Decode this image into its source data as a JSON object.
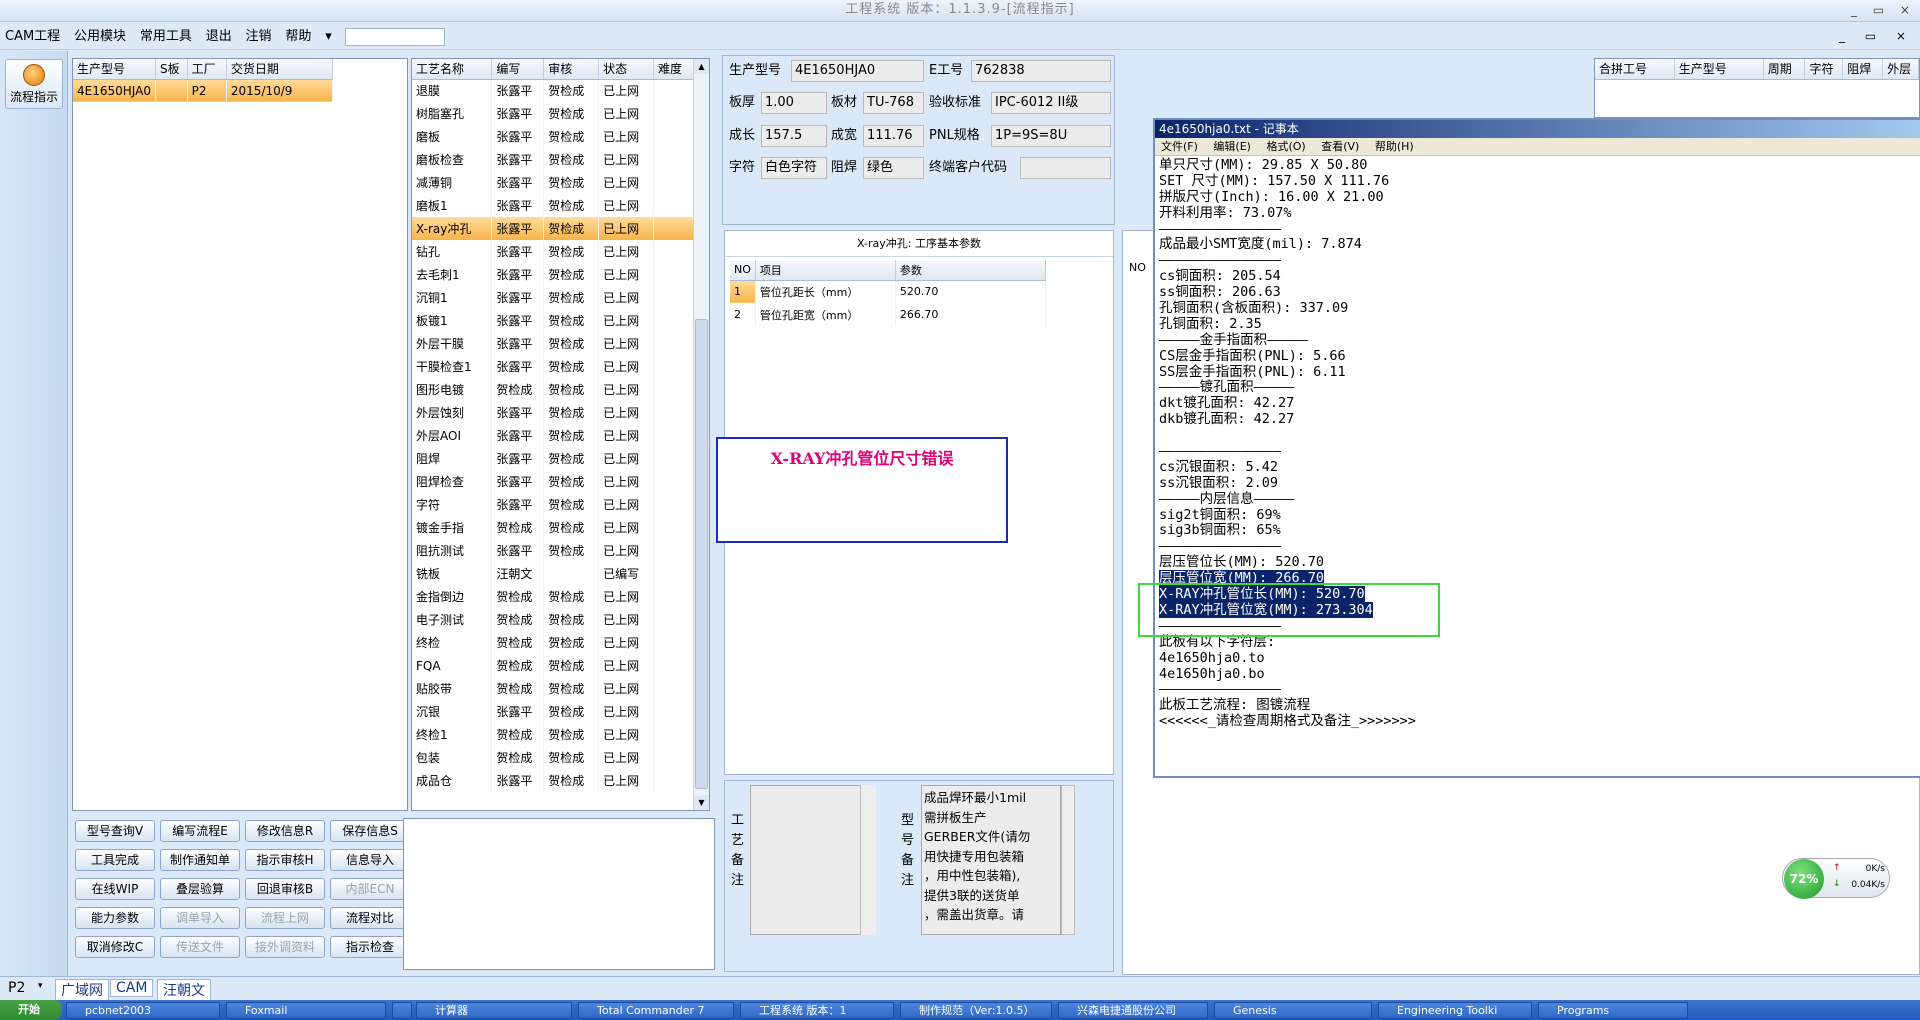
{
  "window": {
    "title": "工程系统  版本：1.1.3.9-[流程指示]",
    "controls": "_ ▭ ×"
  },
  "menu": {
    "items": [
      "CAM工程",
      "公用模块",
      "常用工具",
      "退出",
      "注销",
      "帮助"
    ],
    "mdi_controls": "_ ▭ ×"
  },
  "leftbar": {
    "flow_label": "流程指示"
  },
  "order_grid": {
    "headers": [
      "生产型号",
      "S板",
      "工厂",
      "交货日期"
    ],
    "rows": [
      [
        "4E1650HJA0",
        "",
        "P2",
        "2015/10/9"
      ]
    ]
  },
  "process_grid": {
    "headers": [
      "工艺名称",
      "编写",
      "审核",
      "状态",
      "难度"
    ],
    "rows": [
      [
        "退膜",
        "张露平",
        "贺检成",
        "已上网"
      ],
      [
        "树脂塞孔",
        "张露平",
        "贺检成",
        "已上网"
      ],
      [
        "磨板",
        "张露平",
        "贺检成",
        "已上网"
      ],
      [
        "磨板检查",
        "张露平",
        "贺检成",
        "已上网"
      ],
      [
        "减薄铜",
        "张露平",
        "贺检成",
        "已上网"
      ],
      [
        "磨板1",
        "张露平",
        "贺检成",
        "已上网"
      ],
      [
        "X-ray冲孔",
        "张露平",
        "贺检成",
        "已上网"
      ],
      [
        "钻孔",
        "张露平",
        "贺检成",
        "已上网"
      ],
      [
        "去毛刺1",
        "张露平",
        "贺检成",
        "已上网"
      ],
      [
        "沉铜1",
        "张露平",
        "贺检成",
        "已上网"
      ],
      [
        "板镀1",
        "张露平",
        "贺检成",
        "已上网"
      ],
      [
        "外层干膜",
        "张露平",
        "贺检成",
        "已上网"
      ],
      [
        "干膜检查1",
        "张露平",
        "贺检成",
        "已上网"
      ],
      [
        "图形电镀",
        "贺检成",
        "贺检成",
        "已上网"
      ],
      [
        "外层蚀刻",
        "张露平",
        "贺检成",
        "已上网"
      ],
      [
        "外层AOI",
        "张露平",
        "贺检成",
        "已上网"
      ],
      [
        "阻焊",
        "张露平",
        "贺检成",
        "已上网"
      ],
      [
        "阻焊检查",
        "张露平",
        "贺检成",
        "已上网"
      ],
      [
        "字符",
        "张露平",
        "贺检成",
        "已上网"
      ],
      [
        "镀金手指",
        "贺检成",
        "贺检成",
        "已上网"
      ],
      [
        "阻抗测试",
        "张露平",
        "贺检成",
        "已上网"
      ],
      [
        "铣板",
        "汪朝文",
        "",
        "已编写"
      ],
      [
        "金指倒边",
        "贺检成",
        "贺检成",
        "已上网"
      ],
      [
        "电子测试",
        "贺检成",
        "贺检成",
        "已上网"
      ],
      [
        "终检",
        "贺检成",
        "贺检成",
        "已上网"
      ],
      [
        "FQA",
        "贺检成",
        "贺检成",
        "已上网"
      ],
      [
        "贴胶带",
        "贺检成",
        "贺检成",
        "已上网"
      ],
      [
        "沉银",
        "张露平",
        "贺检成",
        "已上网"
      ],
      [
        "终检1",
        "贺检成",
        "贺检成",
        "已上网"
      ],
      [
        "包装",
        "贺检成",
        "贺检成",
        "已上网"
      ],
      [
        "成品仓",
        "张露平",
        "贺检成",
        "已上网"
      ]
    ]
  },
  "buttons": {
    "row1": [
      "型号查询V",
      "编写流程E",
      "修改信息R",
      "保存信息S"
    ],
    "row2": [
      "工具完成",
      "制作通知单",
      "指示审核H",
      "信息导入"
    ],
    "row3": [
      "在线WIP",
      "叠层验算",
      "回退审核B",
      "内部ECN"
    ],
    "row4": [
      "能力参数",
      "调单导入",
      "流程上网",
      "流程对比"
    ],
    "row5": [
      "取消修改C",
      "传送文件",
      "接外调资料",
      "指示检查"
    ]
  },
  "info": {
    "labels": {
      "model": "生产型号",
      "eno": "E工号",
      "thickness": "板厚",
      "material": "板材",
      "standard": "验收标准",
      "len": "成长",
      "wid": "成宽",
      "pnl": "PNL规格",
      "char": "字符",
      "mask": "阻焊",
      "customer": "终端客户代码"
    },
    "values": {
      "model": "4E1650HJA0",
      "eno": "762838",
      "thickness": "1.00",
      "material": "TU-768",
      "standard": "IPC-6012 II级",
      "len": "157.5",
      "wid": "111.76",
      "pnl": "1P=9S=8U",
      "char": "白色字符",
      "mask": "绿色",
      "customer": ""
    }
  },
  "combine_grid": {
    "headers": [
      "合拼工号",
      "生产型号",
      "周期",
      "字符",
      "阻焊",
      "外层"
    ]
  },
  "params": {
    "title": "X-ray冲孔: 工序基本参数",
    "headers": [
      "NO",
      "项目",
      "参数"
    ],
    "rows": [
      [
        "1",
        "管位孔距长（mm）",
        "520.70"
      ],
      [
        "2",
        "管位孔距宽（mm）",
        "266.70"
      ]
    ]
  },
  "right_grid_header": "NO",
  "error_box": {
    "text": "X-RAY冲孔管位尺寸错误"
  },
  "remarks": {
    "process_label": "工艺备注",
    "model_label": "型号备注",
    "model_text": "成品焊环最小1mil\n需拼板生产\nGERBER文件(请勿\n用快捷专用包装箱\n，用中性包装箱),\n提供3联的送货单\n，需盖出货章。请"
  },
  "notepad": {
    "title": "4e1650hja0.txt - 记事本",
    "menu": [
      "文件(F)",
      "编辑(E)",
      "格式(O)",
      "查看(V)",
      "帮助(H)"
    ],
    "lines_before": [
      "单只尺寸(MM): 29.85 X 50.80",
      "SET 尺寸(MM): 157.50 X 111.76",
      "拼版尺寸(Inch): 16.00 X 21.00",
      "开料利用率: 73.07%",
      "———————————————",
      "成品最小SMT宽度(mil): 7.874",
      "———————————————",
      "cs铜面积: 205.54",
      "ss铜面积: 206.63",
      "孔铜面积(含板面积): 337.09",
      "孔铜面积: 2.35",
      "—————金手指面积—————",
      "CS层金手指面积(PNL): 5.66",
      "SS层金手指面积(PNL): 6.11",
      "—————镀孔面积—————",
      "dkt镀孔面积: 42.27",
      "dkb镀孔面积: 42.27",
      "",
      "———————————————",
      "cs沉银面积: 5.42",
      "ss沉银面积: 2.09",
      "—————内层信息—————",
      "sig2t铜面积: 69%",
      "sig3b铜面积: 65%",
      "———————————————",
      "层压管位长(MM): 520.70"
    ],
    "lines_selected": [
      "层压管位宽(MM): 266.70",
      "X-RAY冲孔管位长(MM): 520.70",
      "X-RAY冲孔管位宽(MM): 273.304"
    ],
    "lines_after": [
      "———————————————",
      "此板有以下字符层:",
      "4e1650hja0.to",
      "4e1650hja0.bo",
      "———————————————",
      "此板工艺流程: 图镀流程",
      "<<<<<<_请检查周期格式及备注_>>>>>>>"
    ]
  },
  "netmon": {
    "percent": "72%",
    "up": "0K/s",
    "down": "0.04K/s"
  },
  "statusbar": {
    "combo": "P2",
    "tabs": [
      "广域网",
      "CAM",
      "汪朝文"
    ]
  },
  "taskbar": {
    "start": "开始",
    "tasks": [
      "pcbnet2003",
      "Foxmail",
      "",
      "计算器",
      "Total Commander 7",
      "工程系统  版本：1",
      "制作规范（Ver:1.0.5）",
      "兴森电捷通股份公司",
      "Genesis",
      "Engineering Toolki",
      "Programs"
    ]
  }
}
